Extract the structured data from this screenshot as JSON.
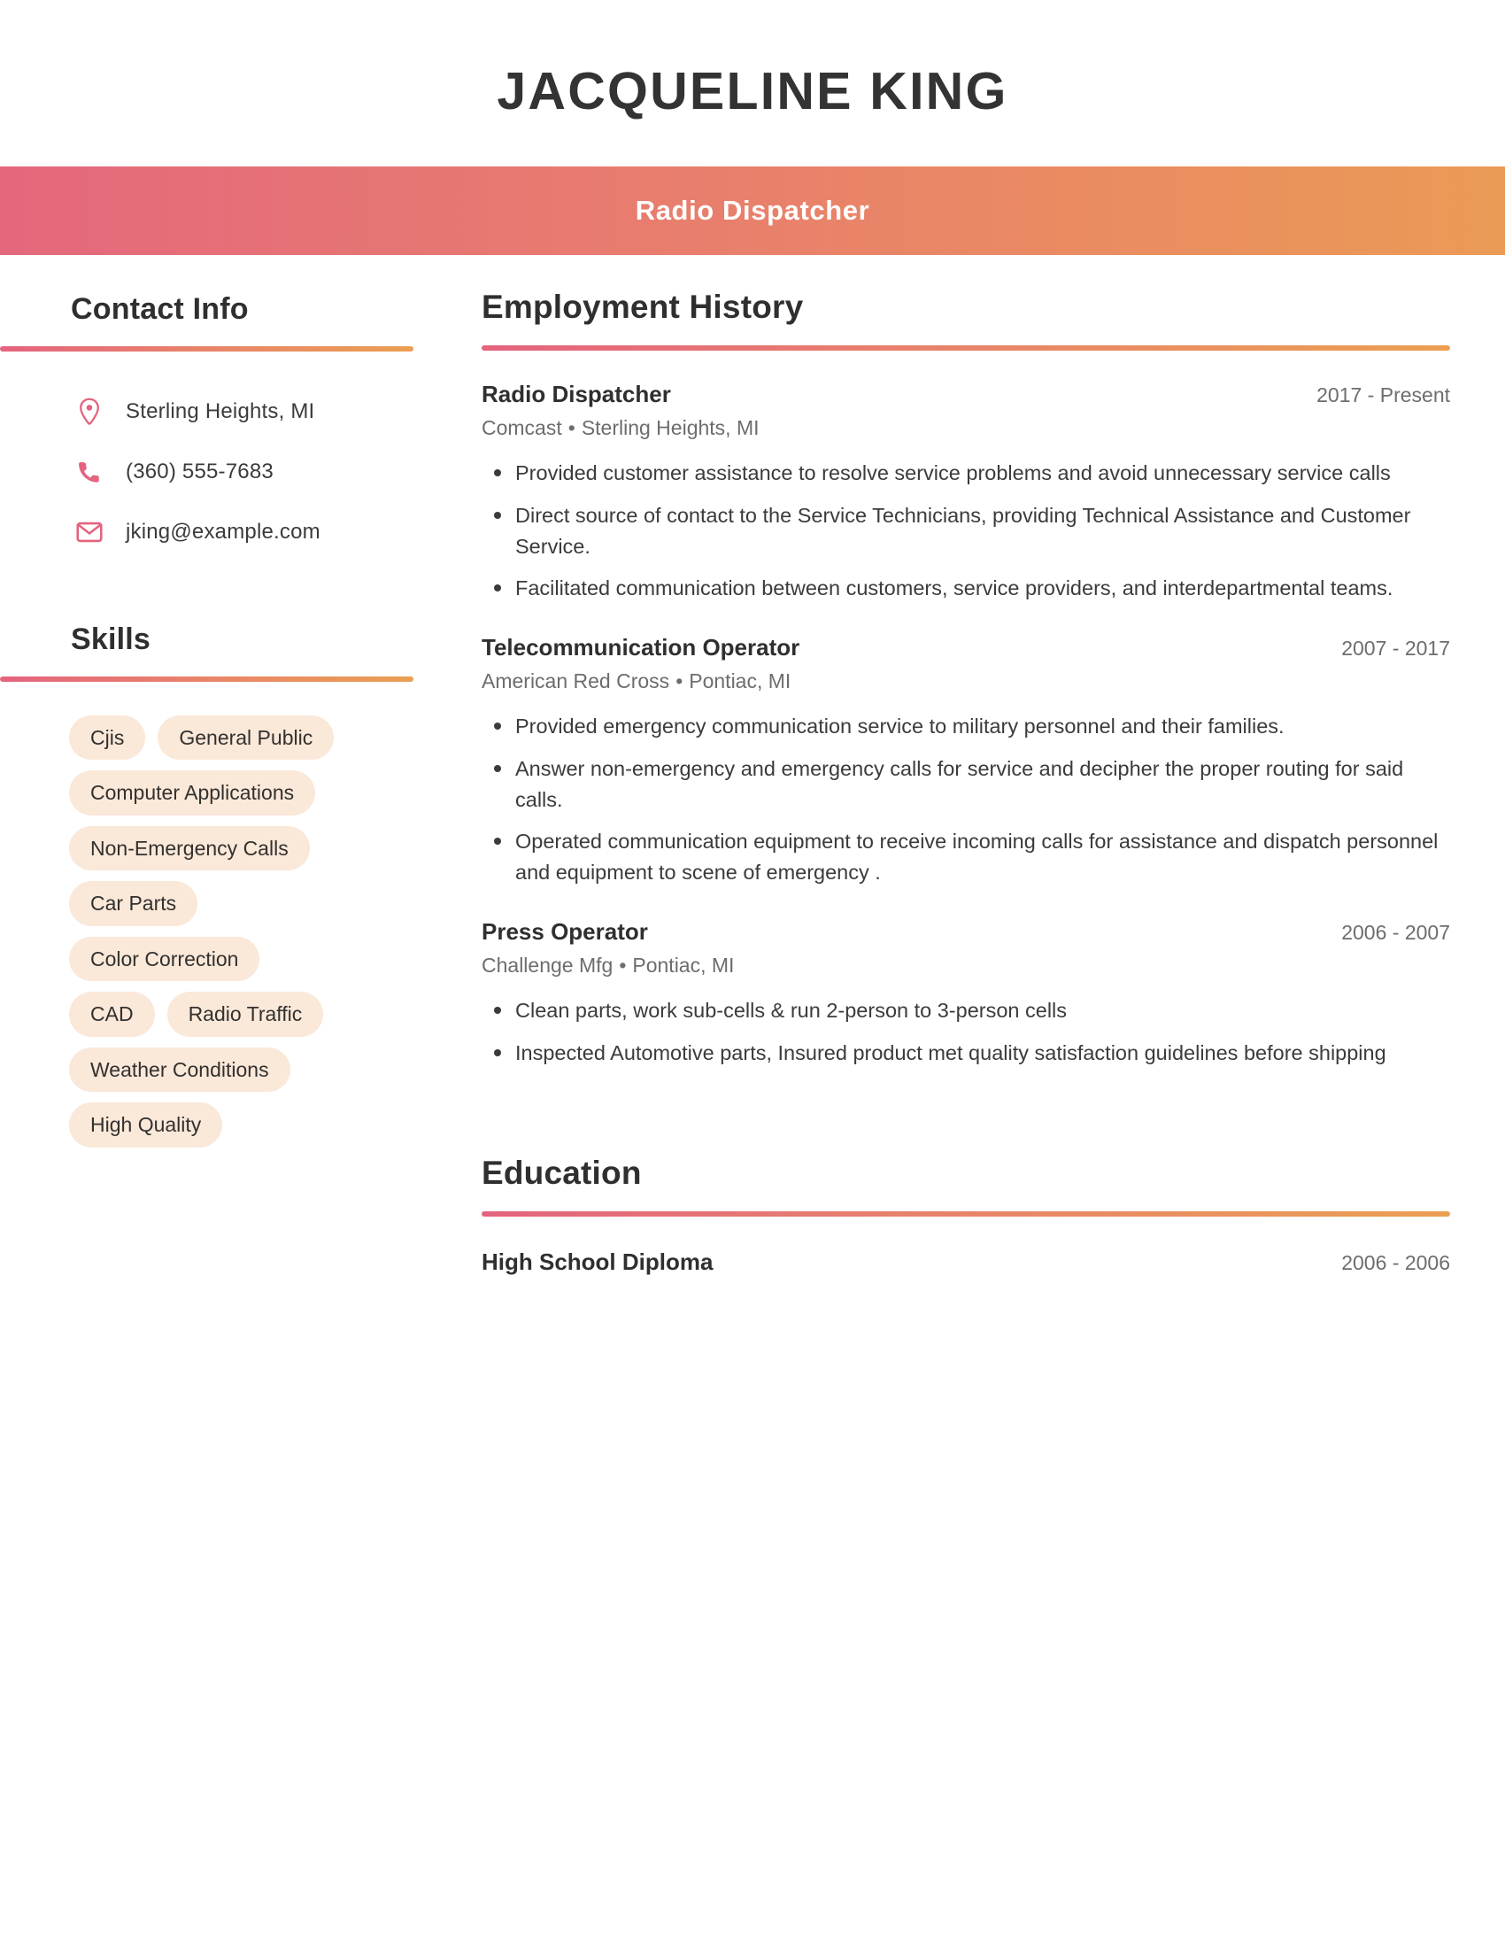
{
  "header": {
    "full_name": "JACQUELINE KING",
    "job_title": "Radio Dispatcher",
    "banner_gradient_start": "#e4687c",
    "banner_gradient_end": "#eb9a56"
  },
  "sidebar": {
    "contact": {
      "heading": "Contact Info",
      "items": [
        {
          "icon": "location-pin-icon",
          "value": "Sterling Heights, MI"
        },
        {
          "icon": "phone-icon",
          "value": "(360) 555-7683"
        },
        {
          "icon": "envelope-icon",
          "value": "jking@example.com"
        }
      ]
    },
    "skills": {
      "heading": "Skills",
      "tag_background": "#fae8d9",
      "items": [
        "Cjis",
        "General Public",
        "Computer Applications",
        "Non-Emergency Calls",
        "Car Parts",
        "Color Correction",
        "CAD",
        "Radio Traffic",
        "Weather Conditions",
        "High Quality"
      ]
    }
  },
  "main": {
    "employment": {
      "heading": "Employment History",
      "jobs": [
        {
          "role": "Radio Dispatcher",
          "dates": "2017 - Present",
          "company": "Comcast",
          "location": "Sterling Heights, MI",
          "bullets": [
            "Provided customer assistance to resolve service problems and avoid unnecessary service calls",
            "Direct source of contact to the Service Technicians, providing Technical Assistance and Customer Service.",
            "Facilitated communication between customers, service providers, and interdepartmental teams."
          ]
        },
        {
          "role": "Telecommunication Operator",
          "dates": "2007 - 2017",
          "company": "American Red Cross",
          "location": "Pontiac, MI",
          "bullets": [
            "Provided emergency communication service to military personnel and their families.",
            "Answer non-emergency and emergency calls for service and decipher the proper routing for said calls.",
            "Operated communication equipment to receive incoming calls for assistance and dispatch personnel and equipment to scene of emergency ."
          ]
        },
        {
          "role": "Press Operator",
          "dates": "2006 - 2007",
          "company": "Challenge Mfg",
          "location": "Pontiac, MI",
          "bullets": [
            "Clean parts, work sub-cells & run 2-person to 3-person cells",
            "Inspected Automotive parts, Insured product met quality satisfaction guidelines before shipping"
          ]
        }
      ]
    },
    "education": {
      "heading": "Education",
      "entries": [
        {
          "degree": "High School Diploma",
          "dates": "2006 - 2006"
        }
      ]
    }
  },
  "separator": "•"
}
